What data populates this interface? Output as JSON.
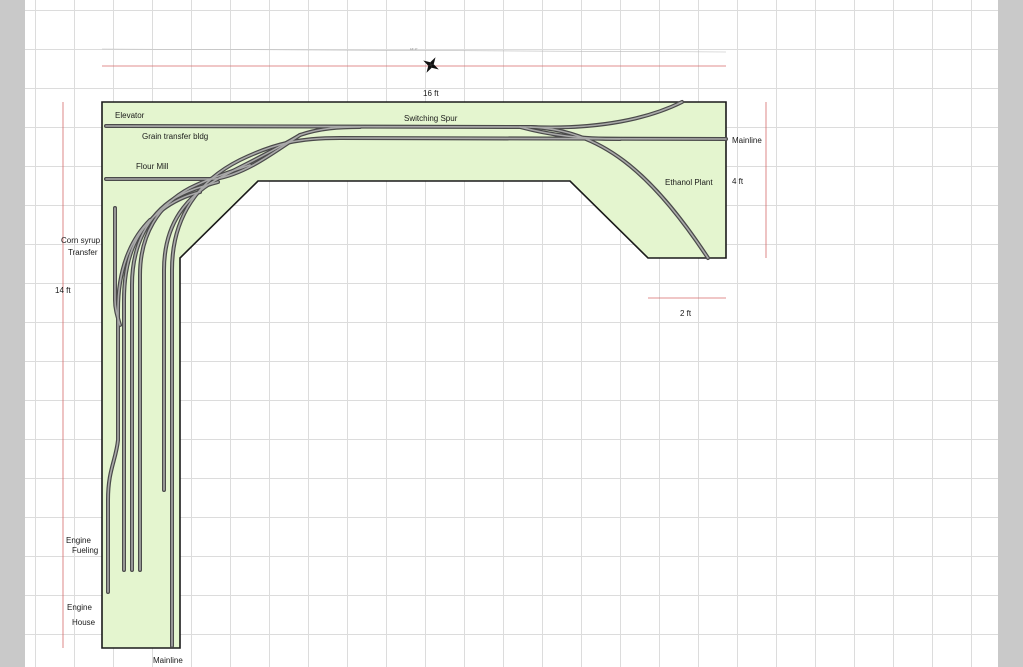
{
  "labels": {
    "elevator": "Elevator",
    "grain_transfer": "Grain transfer bldg",
    "switching_spur": "Switching Spur",
    "flour_mill": "Flour Mill",
    "mainline_east": "Mainline",
    "ethanol_plant": "Ethanol Plant",
    "corn_syrup_line1": "Corn syrup",
    "corn_syrup_line2": "Transfer",
    "engine_fueling_line1": "Engine",
    "engine_fueling_line2": "Fueling",
    "engine_house_line1": "Engine",
    "engine_house_line2": "House",
    "mainline_south": "Mainline"
  },
  "dimensions": {
    "top_width": "16 ft",
    "right_depth": "4 ft",
    "left_length": "14 ft",
    "peninsula_width": "2 ft",
    "top_small_note": "16' 0\""
  },
  "icons": {
    "compass": "compass-rose-icon"
  },
  "colors": {
    "benchwork_fill": "#e4f5cf",
    "benchwork_edge": "#1a1a1a",
    "dimension_line": "#d66a6a",
    "track_bed": "#4a4a4a",
    "track_rail": "#a9a9a9"
  }
}
